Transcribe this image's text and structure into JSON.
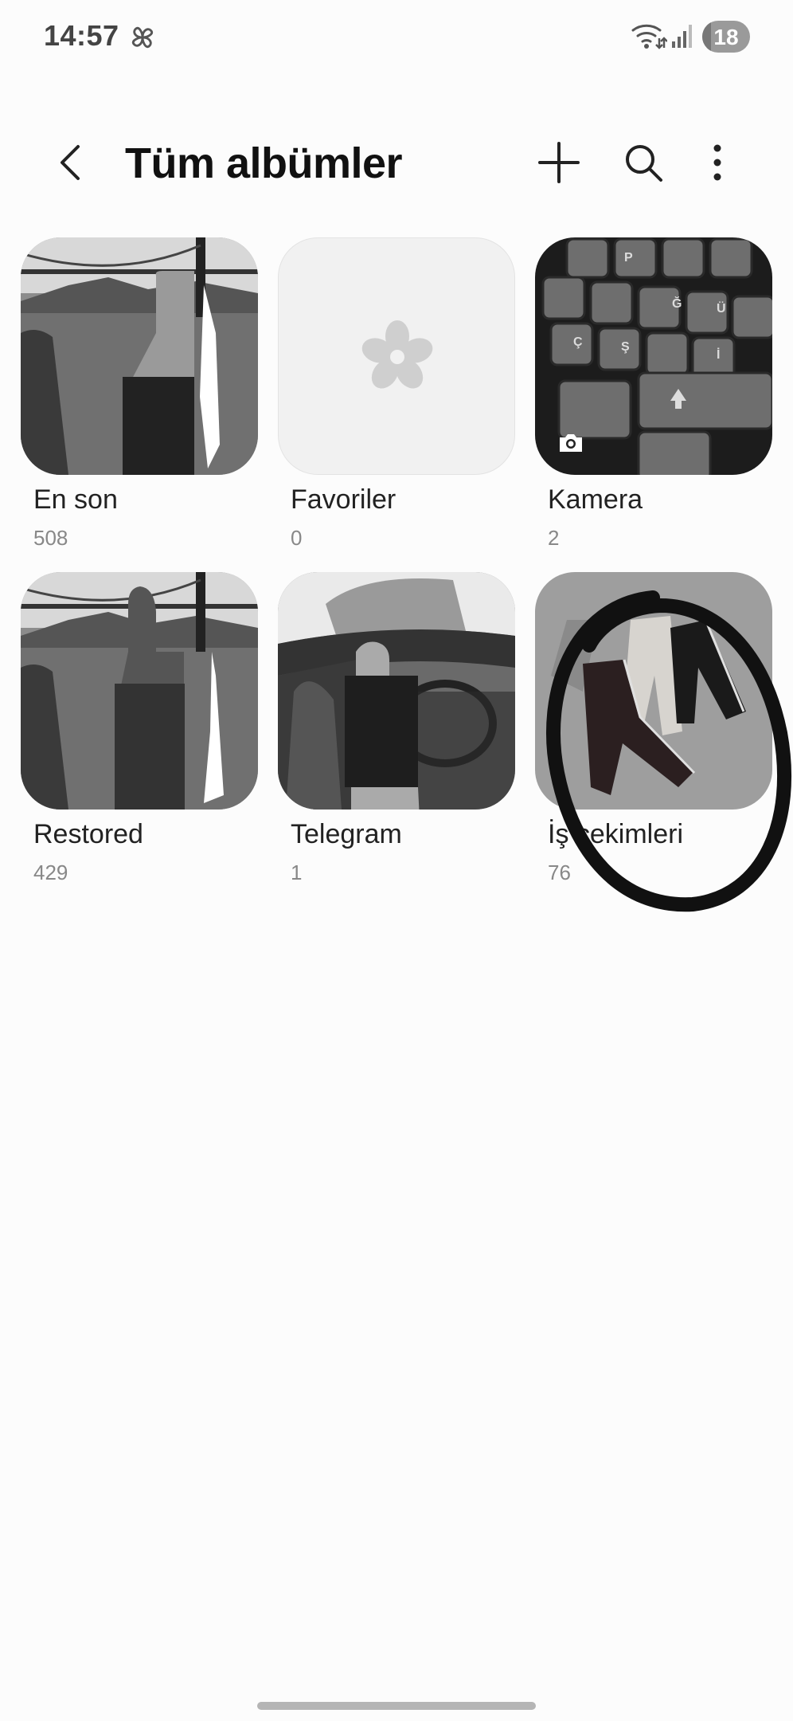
{
  "status_bar": {
    "time": "14:57",
    "battery": "18",
    "battery_level": 0.18
  },
  "header": {
    "title": "Tüm albümler"
  },
  "albums": [
    {
      "name": "En son",
      "count": "508"
    },
    {
      "name": "Favoriler",
      "count": "0"
    },
    {
      "name": "Kamera",
      "count": "2"
    },
    {
      "name": "Restored",
      "count": "429"
    },
    {
      "name": "Telegram",
      "count": "1"
    },
    {
      "name": "İş çekimleri",
      "count": "76"
    }
  ],
  "keyboard_keys": [
    "P",
    "Ğ",
    "Ü",
    "Ş",
    "İ",
    "Ç"
  ],
  "icons": [
    "pinwheel-icon",
    "wifi-icon",
    "signal-icon",
    "back-icon",
    "plus-icon",
    "search-icon",
    "more-vert-icon",
    "flower-icon",
    "camera-icon"
  ]
}
